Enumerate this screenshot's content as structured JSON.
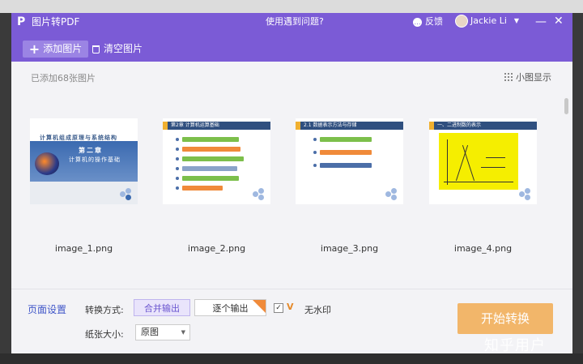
{
  "window": {
    "title": "图片转PDF",
    "help": "使用遇到问题?",
    "feedback": "反馈",
    "user_name": "Jackie Li",
    "minimize": "—",
    "close": "✕"
  },
  "toolbar": {
    "add_label": "添加图片",
    "clear_label": "清空图片"
  },
  "list": {
    "count_text": "已添加68张图片",
    "view_toggle": "小图显示",
    "items": [
      {
        "filename": "image_1.png",
        "slide_title": "计算机组成原理与系统结构",
        "slide_chapter": "第二章",
        "slide_subtitle": "计算机的操作基础"
      },
      {
        "filename": "image_2.png",
        "slide_title": "第2章 计算机运算基础"
      },
      {
        "filename": "image_3.png",
        "slide_title": "2.1 数据表示方法与存储"
      },
      {
        "filename": "image_4.png",
        "slide_title": "一、二进制数的表示"
      }
    ]
  },
  "settings": {
    "section_label": "页面设置",
    "conversion_label": "转换方式:",
    "merge_label": "合并输出",
    "each_label": "逐个输出",
    "no_watermark_label": "无水印",
    "no_watermark_checked": true,
    "paper_label": "纸张大小:",
    "paper_value": "原图"
  },
  "start_label": "开始转换",
  "overlay_watermark": "知乎用户",
  "colors": {
    "brand": "#7b5bd6",
    "accent_link": "#3f55c8",
    "start_button": "#f2b66a"
  }
}
